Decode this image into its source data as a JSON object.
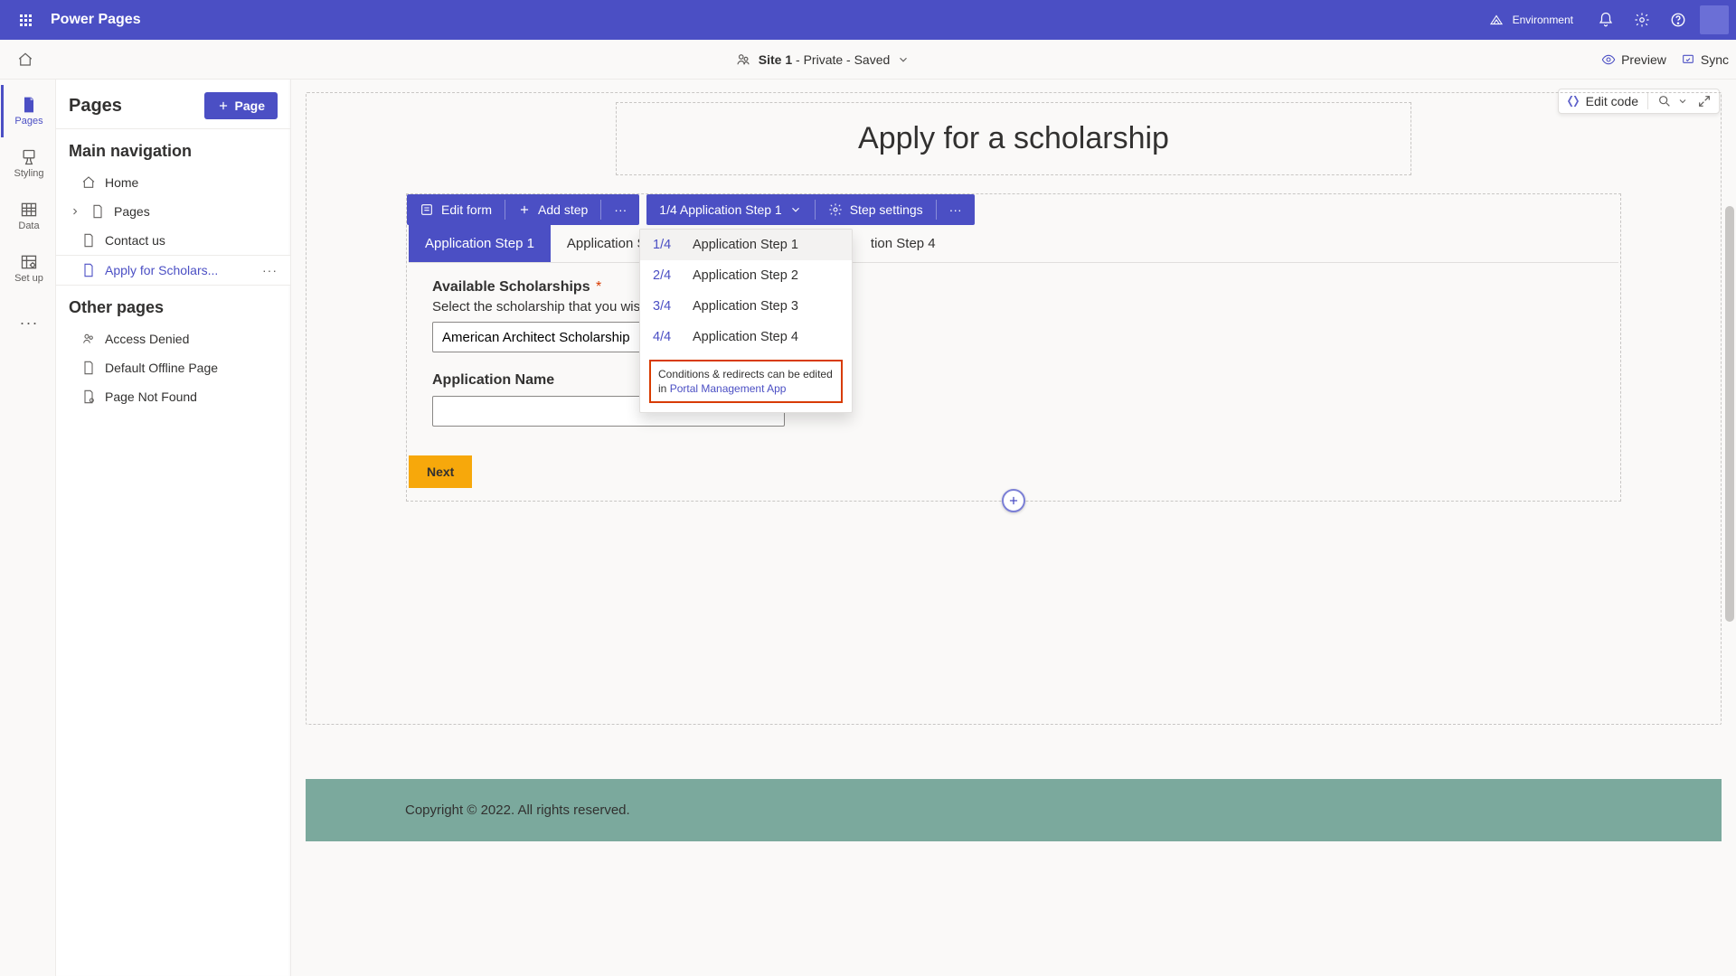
{
  "header": {
    "app_title": "Power Pages",
    "environment_label": "Environment",
    "environment_value": ""
  },
  "command_bar": {
    "site_label_prefix": "Site 1",
    "site_label_suffix": " - Private - Saved",
    "preview": "Preview",
    "sync": "Sync"
  },
  "rail": {
    "pages": "Pages",
    "styling": "Styling",
    "data": "Data",
    "setup": "Set up"
  },
  "side_panel": {
    "title": "Pages",
    "page_btn": "Page",
    "main_nav_title": "Main navigation",
    "items": {
      "home": "Home",
      "pages": "Pages",
      "contact": "Contact us",
      "apply": "Apply for Scholars..."
    },
    "other_title": "Other pages",
    "other": {
      "access_denied": "Access Denied",
      "default_offline": "Default Offline Page",
      "page_not_found": "Page Not Found"
    }
  },
  "canvas_tools": {
    "edit_code": "Edit code"
  },
  "page": {
    "heading": "Apply for a scholarship"
  },
  "form_toolbar": {
    "edit_form": "Edit form",
    "add_step": "Add step",
    "step_indicator": "1/4 Application Step 1",
    "step_settings": "Step settings"
  },
  "tabs": {
    "t1": "Application Step 1",
    "t2": "Application Step 2",
    "t4_partial": "tion Step 4"
  },
  "form": {
    "scholarship_label": "Available Scholarships",
    "scholarship_help": "Select the scholarship that you wis",
    "scholarship_value": "American Architect Scholarship",
    "app_name_label": "Application Name",
    "app_name_value": "",
    "next": "Next"
  },
  "dropdown": {
    "items": [
      {
        "idx": "1/4",
        "label": "Application Step 1"
      },
      {
        "idx": "2/4",
        "label": "Application Step 2"
      },
      {
        "idx": "3/4",
        "label": "Application Step 3"
      },
      {
        "idx": "4/4",
        "label": "Application Step 4"
      }
    ],
    "note_text": "Conditions & redirects can be edited in ",
    "note_link": "Portal Management App"
  },
  "footer": {
    "copyright": "Copyright © 2022. All rights reserved."
  }
}
